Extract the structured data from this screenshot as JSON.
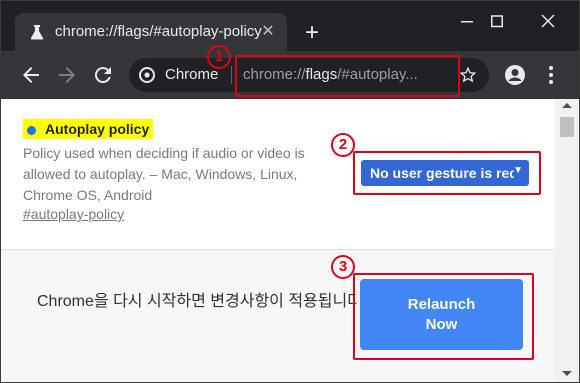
{
  "browser": {
    "tab": {
      "title": "chrome://flags/#autoplay-policy",
      "close_label": "✕"
    },
    "new_tab_label": "+",
    "window_controls": {
      "minimize": "—",
      "maximize": "☐",
      "close": "✕"
    },
    "toolbar": {
      "site_label": "Chrome",
      "url_prefix": "chrome://",
      "url_bold": "flags",
      "url_suffix": "/#autoplay..."
    }
  },
  "annotations": {
    "one": "1",
    "two": "2",
    "three": "3",
    "color": "#e0001b"
  },
  "flag": {
    "title": "Autoplay policy",
    "description": "Policy used when deciding if audio or video is allowed to autoplay. – Mac, Windows, Linux, Chrome OS, Android",
    "link": "#autoplay-policy",
    "selected_option": "No user gesture is required",
    "dropdown_arrow": "▼"
  },
  "relaunch": {
    "message": "Chrome을 다시 시작하면 변경사항이 적용됩니다.",
    "button_line1": "Relaunch",
    "button_line2": "Now"
  },
  "colors": {
    "accent": "#3367d6",
    "relaunch_button": "#4285f4",
    "highlight": "#ffff00"
  }
}
